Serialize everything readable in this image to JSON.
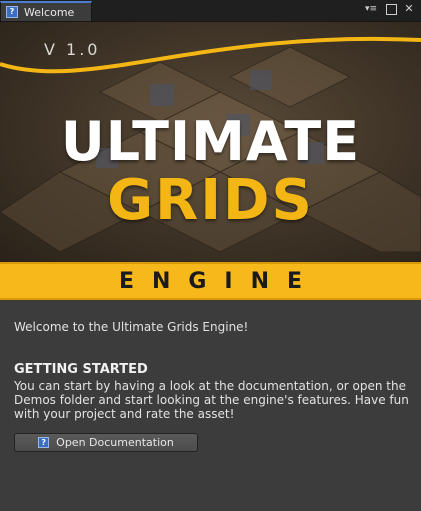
{
  "tab": {
    "title": "Welcome",
    "icon": "help-book-icon"
  },
  "window_controls": {
    "menu_icon": "context-menu-icon",
    "menu_glyph": "▾≡",
    "maximize_icon": "maximize-icon",
    "close_icon": "close-icon",
    "close_glyph": "✕"
  },
  "banner": {
    "version": "V 1.0",
    "title_line1": "ULTIMATE",
    "title_line2": "GRIDS",
    "subtitle": "ENGINE",
    "colors": {
      "accent_yellow": "#f6b81a",
      "title_white": "#ffffff",
      "title_gold": "#f4b614"
    }
  },
  "content": {
    "welcome_text": "Welcome to the Ultimate Grids Engine!",
    "heading": "GETTING STARTED",
    "paragraph": "You can start by having a look at the documentation, or open the Demos folder and start looking at the engine's features. Have fun with your project and rate the asset!",
    "button_label": "Open Documentation",
    "button_icon": "help-book-icon",
    "button_icon_glyph": "?"
  }
}
